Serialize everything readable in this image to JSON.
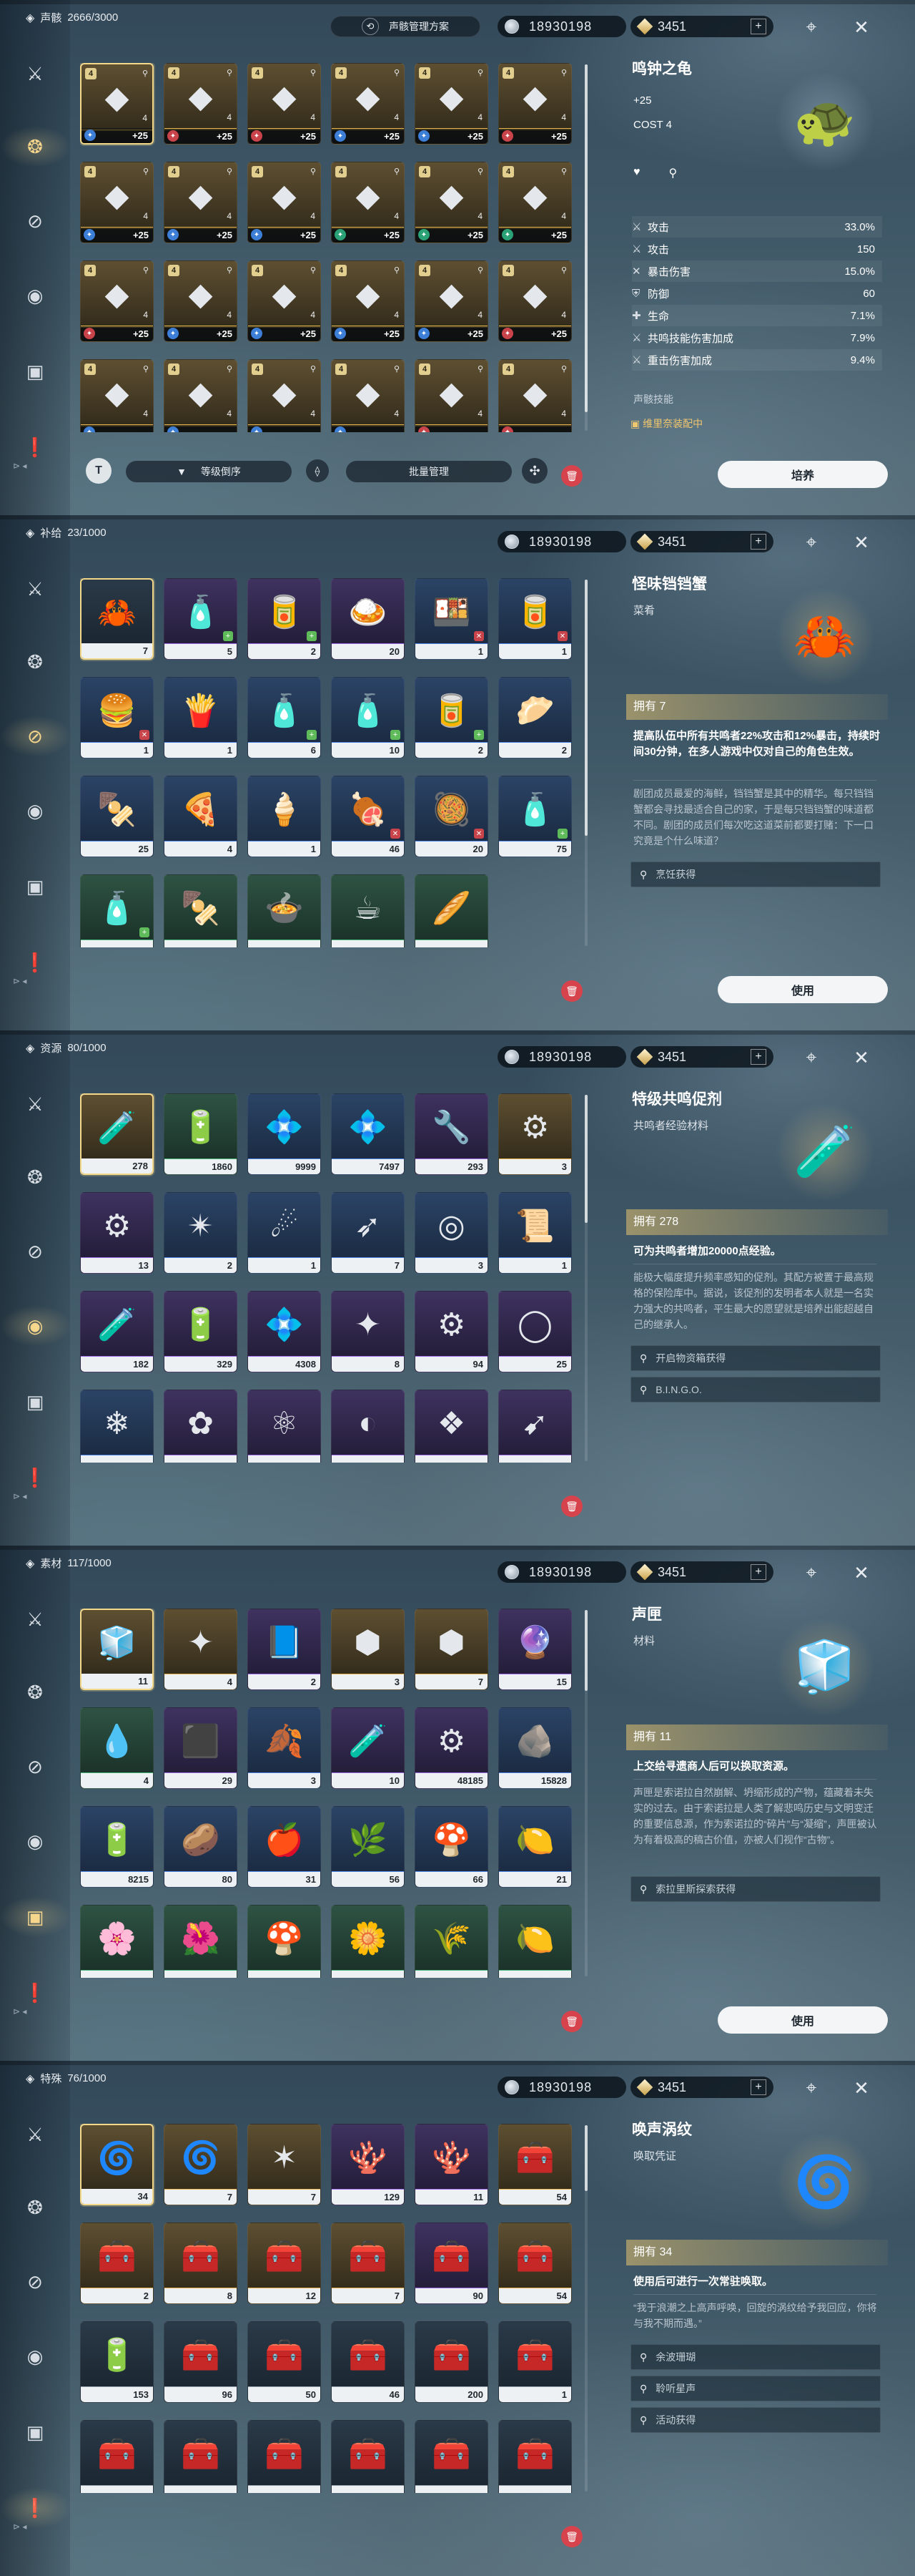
{
  "common": {
    "shell_credits": "18930198",
    "astrite": "3451",
    "plus": "+",
    "trash_icon": "trash-icon"
  },
  "screens": [
    {
      "category": "声骸",
      "capacity": "2666/3000",
      "plan_button": "声骸管理方案",
      "sidebar_active": 1,
      "tiles_kind": "echo",
      "tiles": [
        {
          "q": "q5",
          "lvl": "+25",
          "cost": "4",
          "glyph": "◆",
          "elem": "#3d7ed6",
          "sel": true
        },
        {
          "q": "q5",
          "lvl": "+25",
          "cost": "4",
          "glyph": "◆",
          "elem": "#c9434a"
        },
        {
          "q": "q5",
          "lvl": "+25",
          "cost": "4",
          "glyph": "◆",
          "elem": "#c9434a"
        },
        {
          "q": "q5",
          "lvl": "+25",
          "cost": "4",
          "glyph": "◆",
          "elem": "#3d7ed6"
        },
        {
          "q": "q5",
          "lvl": "+25",
          "cost": "4",
          "glyph": "◆",
          "elem": "#3d7ed6"
        },
        {
          "q": "q5",
          "lvl": "+25",
          "cost": "4",
          "glyph": "◆",
          "elem": "#c9434a"
        },
        {
          "q": "q5",
          "lvl": "+25",
          "cost": "4",
          "glyph": "◆",
          "elem": "#3d7ed6"
        },
        {
          "q": "q5",
          "lvl": "+25",
          "cost": "4",
          "glyph": "◆",
          "elem": "#3d7ed6"
        },
        {
          "q": "q5",
          "lvl": "+25",
          "cost": "4",
          "glyph": "◆",
          "elem": "#3d7ed6"
        },
        {
          "q": "q5",
          "lvl": "+25",
          "cost": "4",
          "glyph": "◆",
          "elem": "#2aa276"
        },
        {
          "q": "q5",
          "lvl": "+25",
          "cost": "4",
          "glyph": "◆",
          "elem": "#2aa276"
        },
        {
          "q": "q5",
          "lvl": "+25",
          "cost": "4",
          "glyph": "◆",
          "elem": "#2aa276"
        },
        {
          "q": "q5",
          "lvl": "+25",
          "cost": "4",
          "glyph": "◆",
          "elem": "#c9434a"
        },
        {
          "q": "q5",
          "lvl": "+25",
          "cost": "4",
          "glyph": "◆",
          "elem": "#3d7ed6"
        },
        {
          "q": "q5",
          "lvl": "+25",
          "cost": "4",
          "glyph": "◆",
          "elem": "#3d7ed6"
        },
        {
          "q": "q5",
          "lvl": "+25",
          "cost": "4",
          "glyph": "◆",
          "elem": "#3d7ed6"
        },
        {
          "q": "q5",
          "lvl": "+25",
          "cost": "4",
          "glyph": "◆",
          "elem": "#3d7ed6"
        },
        {
          "q": "q5",
          "lvl": "+25",
          "cost": "4",
          "glyph": "◆",
          "elem": "#c9434a"
        },
        {
          "q": "q5",
          "lvl": "",
          "cost": "4",
          "glyph": "◆",
          "elem": "#3d7ed6"
        },
        {
          "q": "q5",
          "lvl": "",
          "cost": "4",
          "glyph": "◆",
          "elem": "#3d7ed6"
        },
        {
          "q": "q5",
          "lvl": "",
          "cost": "4",
          "glyph": "◆",
          "elem": "#3d7ed6"
        },
        {
          "q": "q5",
          "lvl": "",
          "cost": "4",
          "glyph": "◆",
          "elem": "#3d7ed6"
        },
        {
          "q": "q5",
          "lvl": "",
          "cost": "4",
          "glyph": "◆",
          "elem": "#c9434a"
        },
        {
          "q": "q5",
          "lvl": "",
          "cost": "4",
          "glyph": "◆",
          "elem": "#c9434a"
        }
      ],
      "scroll": {
        "offset": 0.0,
        "size": 0.95
      },
      "detail": {
        "title": "鸣钟之龟",
        "level": "+25",
        "cost": "COST 4",
        "stats": [
          {
            "icon": "⚔",
            "label": "攻击",
            "value": "33.0%"
          },
          {
            "icon": "⚔",
            "label": "攻击",
            "value": "150"
          },
          {
            "icon": "✕",
            "label": "暴击伤害",
            "value": "15.0%"
          },
          {
            "icon": "⛨",
            "label": "防御",
            "value": "60"
          },
          {
            "icon": "✚",
            "label": "生命",
            "value": "7.1%"
          },
          {
            "icon": "⚔",
            "label": "共鸣技能伤害加成",
            "value": "7.9%"
          },
          {
            "icon": "⚔",
            "label": "重击伤害加成",
            "value": "9.4%"
          }
        ],
        "skill_label": "声骸技能",
        "equip_note": "维里奈装配中"
      },
      "bottom": {
        "sort_label": "等级倒序",
        "batch_label": "批量管理",
        "main_button": "培养"
      }
    },
    {
      "category": "补给",
      "capacity": "23/1000",
      "sidebar_active": 2,
      "tiles_kind": "item",
      "tiles": [
        {
          "q": "q1",
          "count": "7",
          "glyph": "🦀",
          "sel": true
        },
        {
          "q": "q4",
          "count": "5",
          "glyph": "🧴",
          "p": "+"
        },
        {
          "q": "q4",
          "count": "2",
          "glyph": "🥫",
          "p": "+"
        },
        {
          "q": "q4",
          "count": "20",
          "glyph": "🍛"
        },
        {
          "q": "q3",
          "count": "1",
          "glyph": "🍱",
          "x": "✕"
        },
        {
          "q": "q3",
          "count": "1",
          "glyph": "🥫",
          "x": "✕"
        },
        {
          "q": "q3",
          "count": "1",
          "glyph": "🍔",
          "x": "✕"
        },
        {
          "q": "q3",
          "count": "1",
          "glyph": "🍟"
        },
        {
          "q": "q3",
          "count": "6",
          "glyph": "🧴",
          "p": "+"
        },
        {
          "q": "q3",
          "count": "10",
          "glyph": "🧴",
          "p": "+"
        },
        {
          "q": "q3",
          "count": "2",
          "glyph": "🥫",
          "p": "+"
        },
        {
          "q": "q3",
          "count": "2",
          "glyph": "🥟"
        },
        {
          "q": "q3",
          "count": "25",
          "glyph": "🍢"
        },
        {
          "q": "q3",
          "count": "4",
          "glyph": "🍕"
        },
        {
          "q": "q3",
          "count": "1",
          "glyph": "🍦"
        },
        {
          "q": "q3",
          "count": "46",
          "glyph": "🍖",
          "x": "✕"
        },
        {
          "q": "q3",
          "count": "20",
          "glyph": "🥘",
          "x": "✕"
        },
        {
          "q": "q3",
          "count": "75",
          "glyph": "🧴",
          "p": "+"
        },
        {
          "q": "q2",
          "count": "",
          "glyph": "🧴",
          "p": "+"
        },
        {
          "q": "q2",
          "count": "",
          "glyph": "🍢"
        },
        {
          "q": "q2",
          "count": "",
          "glyph": "🍲"
        },
        {
          "q": "q2",
          "count": "",
          "glyph": "☕"
        },
        {
          "q": "q2",
          "count": "",
          "glyph": "🥖"
        }
      ],
      "scroll": {
        "offset": 0.0,
        "size": 0.7
      },
      "detail": {
        "title": "怪味铛铛蟹",
        "subtitle": "菜肴",
        "owned": "拥有 7",
        "effect": "提高队伍中所有共鸣者22%攻击和12%暴击，持续时间30分钟，在多人游戏中仅对自己的角色生效。",
        "description": "剧团成员最爱的海鲜，铛铛蟹是其中的精华。每只铛铛蟹都会寻找最适合自己的家，于是每只铛铛蟹的味道都不同。剧团的成员们每次吃这道菜前都要打赌：下一口究竟是个什么味道？",
        "sources": [
          "烹饪获得"
        ]
      },
      "bottom": {
        "main_button": "使用"
      }
    },
    {
      "category": "资源",
      "capacity": "80/1000",
      "sidebar_active": 3,
      "tiles_kind": "item",
      "tiles": [
        {
          "q": "q5",
          "count": "278",
          "glyph": "🧪",
          "sel": true
        },
        {
          "q": "q2",
          "count": "1860",
          "glyph": "🔋"
        },
        {
          "q": "q3",
          "count": "9999",
          "glyph": "💠"
        },
        {
          "q": "q3",
          "count": "7497",
          "glyph": "💠"
        },
        {
          "q": "q4",
          "count": "293",
          "glyph": "🔧"
        },
        {
          "q": "q5",
          "count": "3",
          "glyph": "⚙"
        },
        {
          "q": "q4",
          "count": "13",
          "glyph": "⚙"
        },
        {
          "q": "q3",
          "count": "2",
          "glyph": "✴"
        },
        {
          "q": "q3",
          "count": "1",
          "glyph": "☄"
        },
        {
          "q": "q3",
          "count": "7",
          "glyph": "➶"
        },
        {
          "q": "q3",
          "count": "3",
          "glyph": "◎"
        },
        {
          "q": "q3",
          "count": "1",
          "glyph": "📜"
        },
        {
          "q": "q4",
          "count": "182",
          "glyph": "🧪"
        },
        {
          "q": "q4",
          "count": "329",
          "glyph": "🔋"
        },
        {
          "q": "q4",
          "count": "4308",
          "glyph": "💠"
        },
        {
          "q": "q4",
          "count": "8",
          "glyph": "✦"
        },
        {
          "q": "q4",
          "count": "94",
          "glyph": "⚙"
        },
        {
          "q": "q4",
          "count": "25",
          "glyph": "◯"
        },
        {
          "q": "q3",
          "count": "",
          "glyph": "❄"
        },
        {
          "q": "q4",
          "count": "",
          "glyph": "✿"
        },
        {
          "q": "q4",
          "count": "",
          "glyph": "⚛"
        },
        {
          "q": "q4",
          "count": "",
          "glyph": "◐"
        },
        {
          "q": "q4",
          "count": "",
          "glyph": "❖"
        },
        {
          "q": "q4",
          "count": "",
          "glyph": "➹"
        }
      ],
      "scroll": {
        "offset": 0.0,
        "size": 0.35
      },
      "detail": {
        "title": "特级共鸣促剂",
        "subtitle": "共鸣者经验材料",
        "owned": "拥有 278",
        "effect": "可为共鸣者增加20000点经验。",
        "description": "能极大幅度提升频率感知的促剂。其配方被置于最高规格的保险库中。据说，该促剂的发明者本人就是一名实力强大的共鸣者，平生最大的愿望就是培养出能超越自己的继承人。",
        "sources": [
          "开启物资箱获得",
          "B.I.N.G.O."
        ]
      },
      "bottom": {}
    },
    {
      "category": "素材",
      "capacity": "117/1000",
      "sidebar_active": 4,
      "tiles_kind": "item",
      "tiles": [
        {
          "q": "q5",
          "count": "11",
          "glyph": "🧊",
          "sel": true
        },
        {
          "q": "q5",
          "count": "4",
          "glyph": "✦"
        },
        {
          "q": "q4",
          "count": "2",
          "glyph": "📘"
        },
        {
          "q": "q5",
          "count": "3",
          "glyph": "⬢"
        },
        {
          "q": "q5",
          "count": "7",
          "glyph": "⬢"
        },
        {
          "q": "q4",
          "count": "15",
          "glyph": "🔮"
        },
        {
          "q": "q2",
          "count": "4",
          "glyph": "💧"
        },
        {
          "q": "q4",
          "count": "29",
          "glyph": "⬛"
        },
        {
          "q": "q3",
          "count": "3",
          "glyph": "🍂"
        },
        {
          "q": "q4",
          "count": "10",
          "glyph": "🧪"
        },
        {
          "q": "q4",
          "count": "48185",
          "glyph": "⚙"
        },
        {
          "q": "q3",
          "count": "15828",
          "glyph": "🪨"
        },
        {
          "q": "q3",
          "count": "8215",
          "glyph": "🔋"
        },
        {
          "q": "q3",
          "count": "80",
          "glyph": "🥔"
        },
        {
          "q": "q3",
          "count": "31",
          "glyph": "🍎"
        },
        {
          "q": "q3",
          "count": "56",
          "glyph": "🌿"
        },
        {
          "q": "q3",
          "count": "66",
          "glyph": "🍄"
        },
        {
          "q": "q3",
          "count": "21",
          "glyph": "🍋"
        },
        {
          "q": "q2",
          "count": "",
          "glyph": "🌸"
        },
        {
          "q": "q2",
          "count": "",
          "glyph": "🌺"
        },
        {
          "q": "q2",
          "count": "",
          "glyph": "🍄"
        },
        {
          "q": "q2",
          "count": "",
          "glyph": "🌼"
        },
        {
          "q": "q2",
          "count": "",
          "glyph": "🌾"
        },
        {
          "q": "q2",
          "count": "",
          "glyph": "🍋"
        }
      ],
      "scroll": {
        "offset": 0.0,
        "size": 0.22
      },
      "detail": {
        "title": "声匣",
        "subtitle": "材料",
        "owned": "拥有 11",
        "effect": "上交给寻遗商人后可以换取资源。",
        "description": "声匣是索诺拉自然崩解、坍缩形成的产物，蕴藏着未失实的过去。由于索诺拉是人类了解悲鸣历史与文明变迁的重要信息源，作为索诺拉的“碎片”与“凝缩”，声匣被认为有着极高的稿古价值，亦被人们视作“古物”。",
        "sources": [
          "索拉里斯探索获得"
        ]
      },
      "bottom": {
        "main_button": "使用"
      }
    },
    {
      "category": "特殊",
      "capacity": "76/1000",
      "sidebar_active": 5,
      "tiles_kind": "item",
      "tiles": [
        {
          "q": "q5",
          "count": "34",
          "glyph": "🌀",
          "sel": true
        },
        {
          "q": "q5",
          "count": "7",
          "glyph": "🌀"
        },
        {
          "q": "q5",
          "count": "7",
          "glyph": "✶"
        },
        {
          "q": "q4",
          "count": "129",
          "glyph": "🪸"
        },
        {
          "q": "q4",
          "count": "11",
          "glyph": "🪸"
        },
        {
          "q": "q5",
          "count": "54",
          "glyph": "🧰"
        },
        {
          "q": "q5",
          "count": "2",
          "glyph": "🧰"
        },
        {
          "q": "q5",
          "count": "8",
          "glyph": "🧰"
        },
        {
          "q": "q5",
          "count": "12",
          "glyph": "🧰"
        },
        {
          "q": "q5",
          "count": "7",
          "glyph": "🧰"
        },
        {
          "q": "q4",
          "count": "90",
          "glyph": "🧰"
        },
        {
          "q": "q5",
          "count": "54",
          "glyph": "🧰"
        },
        {
          "q": "q1",
          "count": "153",
          "glyph": "🔋"
        },
        {
          "q": "q1",
          "count": "96",
          "glyph": "🧰"
        },
        {
          "q": "q1",
          "count": "50",
          "glyph": "🧰"
        },
        {
          "q": "q1",
          "count": "46",
          "glyph": "🧰"
        },
        {
          "q": "q1",
          "count": "200",
          "glyph": "🧰"
        },
        {
          "q": "q1",
          "count": "1",
          "glyph": "🧰"
        },
        {
          "q": "q1",
          "count": "",
          "glyph": "🧰"
        },
        {
          "q": "q1",
          "count": "",
          "glyph": "🧰"
        },
        {
          "q": "q1",
          "count": "",
          "glyph": "🧰"
        },
        {
          "q": "q1",
          "count": "",
          "glyph": "🧰"
        },
        {
          "q": "q1",
          "count": "",
          "glyph": "🧰"
        },
        {
          "q": "q1",
          "count": "",
          "glyph": "🧰"
        }
      ],
      "scroll": {
        "offset": 0.0,
        "size": 0.18
      },
      "detail": {
        "title": "唤声涡纹",
        "subtitle": "唤取凭证",
        "owned": "拥有 34",
        "effect": "使用后可进行一次常驻唤取。",
        "description": "“我于浪潮之上高声呼唤，回旋的涡纹给予我回应，你将与我不期而遇。”",
        "sources": [
          "余波珊瑚",
          "聆听星声",
          "活动获得"
        ]
      },
      "bottom": {}
    }
  ],
  "sidebar_icons": [
    "crossed-swords-icon",
    "echo-mask-icon",
    "supply-capsule-icon",
    "resource-gear-icon",
    "material-box-icon",
    "special-tag-icon"
  ],
  "sidebar_glyphs": [
    "⚔",
    "❂",
    "⊘",
    "◉",
    "▣",
    "❗"
  ]
}
